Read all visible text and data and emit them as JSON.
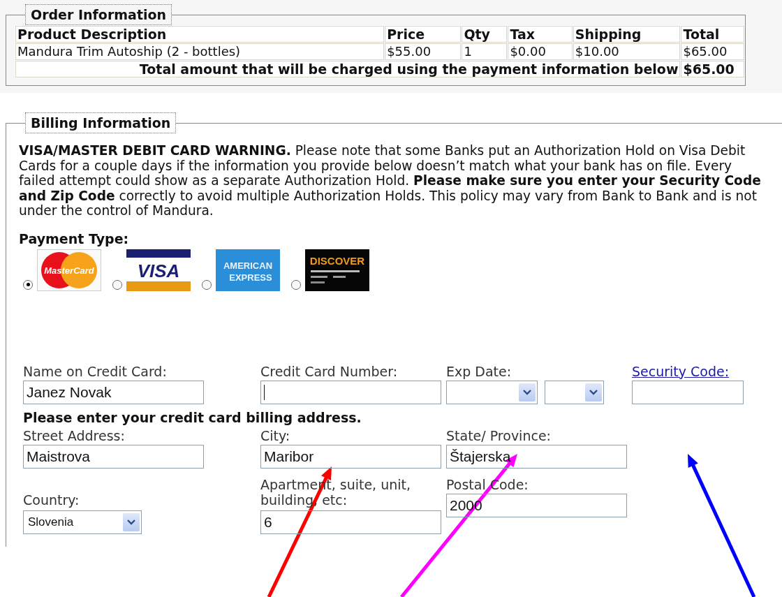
{
  "order": {
    "legend": "Order Information",
    "columns": [
      "Product Description",
      "Price",
      "Qty",
      "Tax",
      "Shipping",
      "Total"
    ],
    "rows": [
      [
        "Mandura Trim Autoship (2 - bottles)",
        "$55.00",
        "1",
        "$0.00",
        "$10.00",
        "$65.00"
      ]
    ],
    "total_label": "Total amount that will be charged using the payment information below",
    "total_value": "$65.00"
  },
  "billing": {
    "legend": "Billing Information",
    "warning": "**VISA/MASTER DEBIT CARD WARNING.** Please note that some Banks put an Authorization Hold on Visa Debit Cards for a couple days if the information you provide below doesn’t match what your bank has on file. Every failed attempt could show as a separate Authorization Hold. **Please make sure you enter your Security Code and Zip Code** correctly to avoid multiple Authorization Holds. This policy may vary from Bank to Bank and is not under the control of Mandura.",
    "payment_label": "Payment Type:",
    "payment_options": [
      {
        "kind": "mastercard",
        "logo_text": "MasterCard",
        "selected": true
      },
      {
        "kind": "visa",
        "logo_text": "VISA",
        "selected": false
      },
      {
        "kind": "amex",
        "logo_text": [
          "AMERICAN",
          "EXPRESS"
        ],
        "selected": false
      },
      {
        "kind": "discover",
        "logo_text": "DISCOVER",
        "selected": false
      }
    ],
    "card_fields": [
      {
        "kind": "text",
        "label": "Name on Credit Card:",
        "value": "Janez Novak"
      },
      {
        "kind": "text",
        "label": "Credit Card Number:",
        "focused": true
      },
      {
        "kind": "date",
        "label": "Exp Date:"
      },
      {
        "kind": "link",
        "label": "Security Code:"
      }
    ],
    "address_heading": "Please enter your credit card billing address.",
    "address_fields": [
      {
        "kind": "text",
        "label": "Street Address:",
        "value": "Maistrova"
      },
      {
        "kind": "text",
        "label": "City:",
        "value": "Maribor"
      },
      {
        "kind": "text",
        "label": "State/ Province:",
        "value": "Štajerska"
      },
      {
        "kind": "select",
        "label": "Country:",
        "value": "Slovenia"
      },
      {
        "kind": "text",
        "label": "Apartment, suite, unit, building, etc:",
        "value": "6"
      },
      {
        "kind": "text",
        "label": "Postal Code:",
        "value": "2000"
      }
    ]
  },
  "annotations": [
    {
      "kind": "arrow",
      "color": "#ff0000"
    },
    {
      "kind": "arrow",
      "color": "#ff00ff"
    },
    {
      "kind": "arrow",
      "color": "#0000ff"
    }
  ]
}
